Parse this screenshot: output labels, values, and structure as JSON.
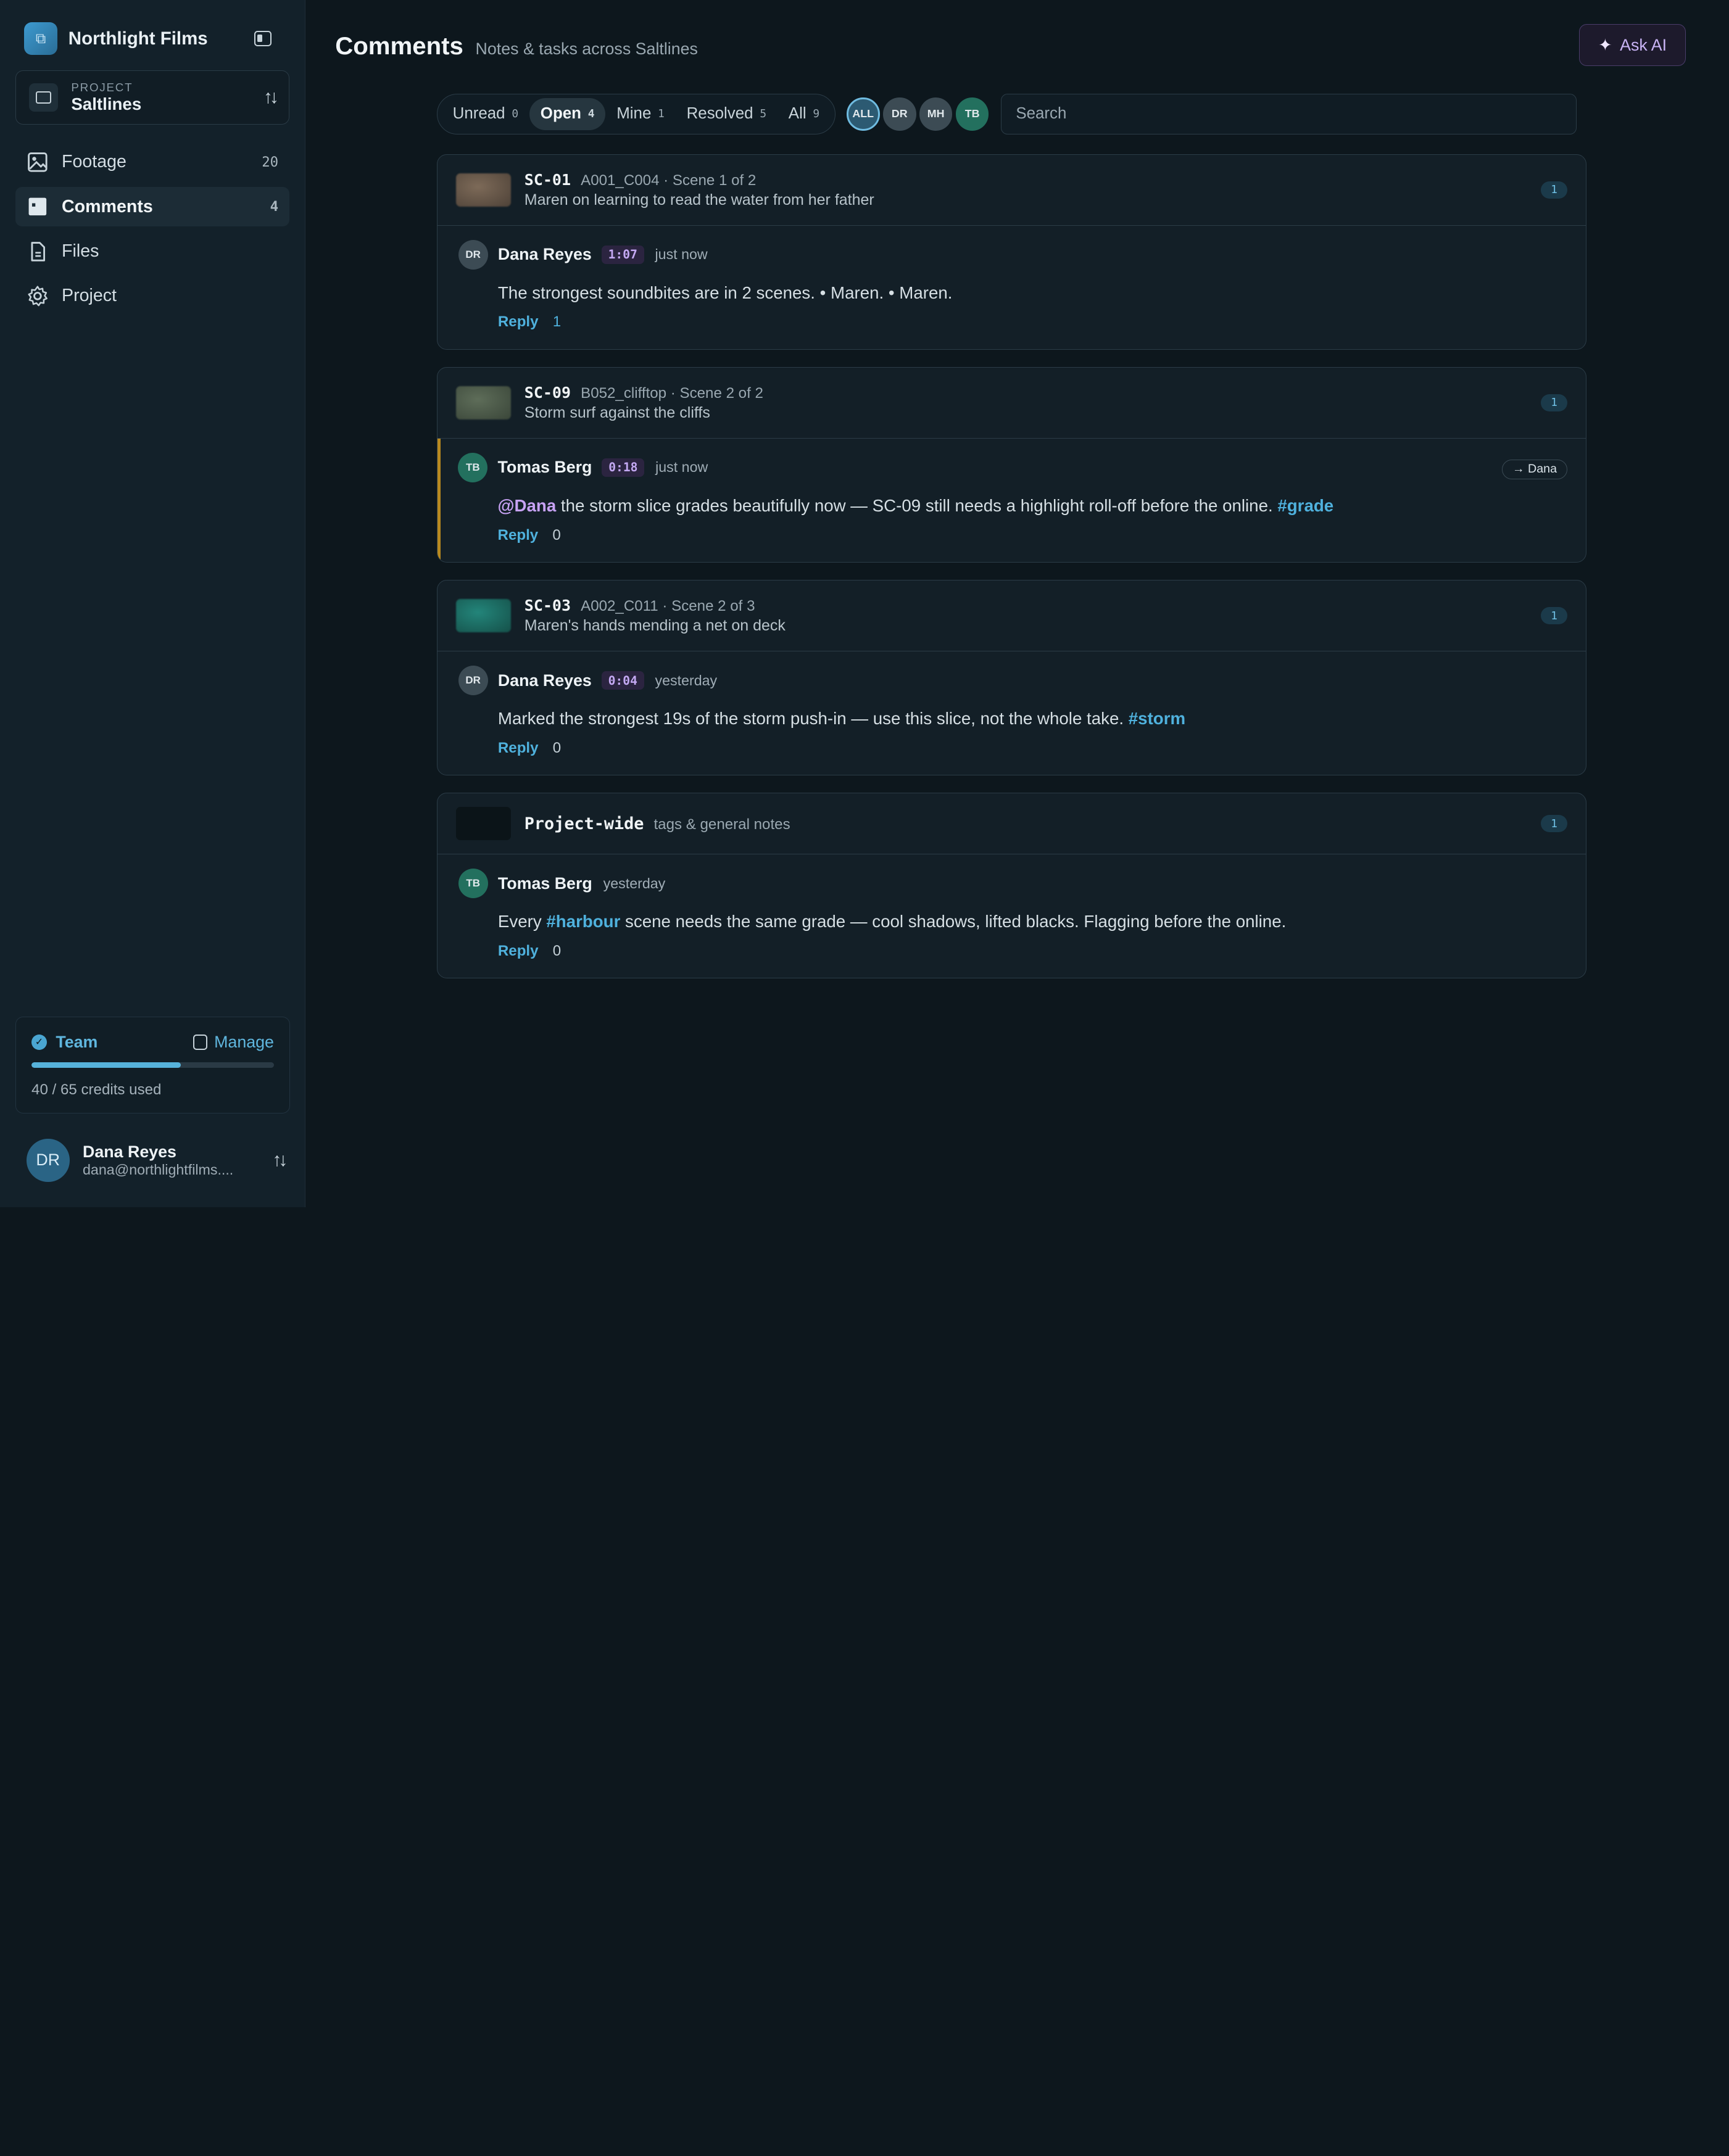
{
  "org": {
    "name": "Northlight Films",
    "logo_glyph": "⧉"
  },
  "project": {
    "label": "PROJECT",
    "name": "Saltlines"
  },
  "nav": [
    {
      "label": "Footage",
      "count": "20",
      "icon": "image-icon"
    },
    {
      "label": "Comments",
      "count": "4",
      "icon": "comment-icon"
    },
    {
      "label": "Files",
      "count": "",
      "icon": "file-icon"
    },
    {
      "label": "Project",
      "count": "",
      "icon": "gear-icon"
    }
  ],
  "team": {
    "label": "Team",
    "manage_label": "Manage",
    "credits_text": "40 / 65 credits used",
    "credits_used": 40,
    "credits_total": 65
  },
  "user": {
    "initials": "DR",
    "name": "Dana Reyes",
    "email": "dana@northlightfilms...."
  },
  "header": {
    "title": "Comments",
    "subtitle": "Notes & tasks across Saltlines",
    "ask_ai_label": "Ask AI"
  },
  "filters": [
    {
      "label": "Unread",
      "count": "0"
    },
    {
      "label": "Open",
      "count": "4"
    },
    {
      "label": "Mine",
      "count": "1"
    },
    {
      "label": "Resolved",
      "count": "5"
    },
    {
      "label": "All",
      "count": "9"
    }
  ],
  "people": [
    "ALL",
    "DR",
    "MH",
    "TB"
  ],
  "search": {
    "placeholder": "Search"
  },
  "threads": [
    {
      "scene_id": "SC-01",
      "meta": "A001_C004 · Scene 1 of 2",
      "desc": "Maren on learning to read the water from her father",
      "badge": "1",
      "thumb_color": "#6a5a4c",
      "comment": {
        "initials": "DR",
        "author": "Dana Reyes",
        "timecode": "1:07",
        "time": "just now",
        "text": "The strongest soundbites are in 2 scenes. • Maren. • Maren.",
        "reply_label": "Reply",
        "reply_count": "1"
      }
    },
    {
      "scene_id": "SC-09",
      "meta": "B052_clifftop · Scene 2 of 2",
      "desc": "Storm surf against the cliffs",
      "badge": "1",
      "thumb_color": "#4d5c4c",
      "comment": {
        "initials": "TB",
        "author": "Tomas Berg",
        "timecode": "0:18",
        "time": "just now",
        "assignee": "→ Dana",
        "mention": "@Dana",
        "text": " the storm slice grades beautifully now — SC-09 still needs a highlight roll-off before the online. ",
        "tag": "#grade",
        "reply_label": "Reply",
        "reply_count": "0"
      }
    },
    {
      "scene_id": "SC-03",
      "meta": "A002_C011 · Scene 2 of 3",
      "desc": "Maren's hands mending a net on deck",
      "badge": "1",
      "thumb_color": "#1f6a62",
      "comment": {
        "initials": "DR",
        "author": "Dana Reyes",
        "timecode": "0:04",
        "time": "yesterday",
        "text": "Marked the strongest 19s of the storm push-in — use this slice, not the whole take. ",
        "tag": "#storm",
        "reply_label": "Reply",
        "reply_count": "0"
      }
    },
    {
      "title": "Project-wide",
      "meta": "tags & general notes",
      "badge": "1",
      "thumb_color": "#0e171c",
      "comment": {
        "initials": "TB",
        "author": "Tomas Berg",
        "time": "yesterday",
        "text_before": "Every ",
        "tag": "#harbour",
        "text_after": " scene needs the same grade — cool shadows, lifted blacks. Flagging before the online.",
        "reply_label": "Reply",
        "reply_count": "0"
      }
    }
  ],
  "colors": {
    "accent": "#4fb1dd",
    "mention": "#c7a2f4",
    "flag": "#b8891f",
    "background": "#0d171d"
  }
}
